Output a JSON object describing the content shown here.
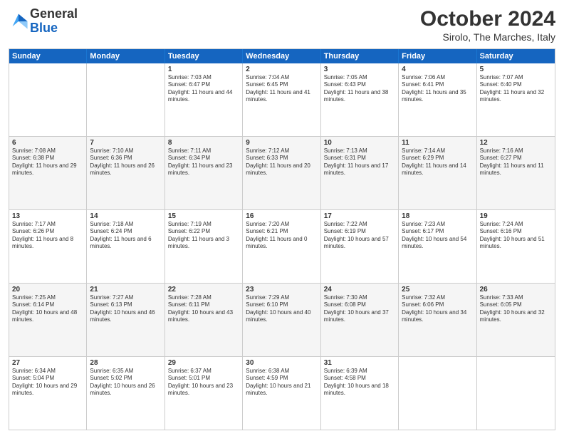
{
  "header": {
    "logo_general": "General",
    "logo_blue": "Blue",
    "month": "October 2024",
    "location": "Sirolo, The Marches, Italy"
  },
  "days_of_week": [
    "Sunday",
    "Monday",
    "Tuesday",
    "Wednesday",
    "Thursday",
    "Friday",
    "Saturday"
  ],
  "rows": [
    {
      "alt": false,
      "cells": [
        {
          "day": "",
          "text": ""
        },
        {
          "day": "",
          "text": ""
        },
        {
          "day": "1",
          "text": "Sunrise: 7:03 AM\nSunset: 6:47 PM\nDaylight: 11 hours and 44 minutes."
        },
        {
          "day": "2",
          "text": "Sunrise: 7:04 AM\nSunset: 6:45 PM\nDaylight: 11 hours and 41 minutes."
        },
        {
          "day": "3",
          "text": "Sunrise: 7:05 AM\nSunset: 6:43 PM\nDaylight: 11 hours and 38 minutes."
        },
        {
          "day": "4",
          "text": "Sunrise: 7:06 AM\nSunset: 6:41 PM\nDaylight: 11 hours and 35 minutes."
        },
        {
          "day": "5",
          "text": "Sunrise: 7:07 AM\nSunset: 6:40 PM\nDaylight: 11 hours and 32 minutes."
        }
      ]
    },
    {
      "alt": true,
      "cells": [
        {
          "day": "6",
          "text": "Sunrise: 7:08 AM\nSunset: 6:38 PM\nDaylight: 11 hours and 29 minutes."
        },
        {
          "day": "7",
          "text": "Sunrise: 7:10 AM\nSunset: 6:36 PM\nDaylight: 11 hours and 26 minutes."
        },
        {
          "day": "8",
          "text": "Sunrise: 7:11 AM\nSunset: 6:34 PM\nDaylight: 11 hours and 23 minutes."
        },
        {
          "day": "9",
          "text": "Sunrise: 7:12 AM\nSunset: 6:33 PM\nDaylight: 11 hours and 20 minutes."
        },
        {
          "day": "10",
          "text": "Sunrise: 7:13 AM\nSunset: 6:31 PM\nDaylight: 11 hours and 17 minutes."
        },
        {
          "day": "11",
          "text": "Sunrise: 7:14 AM\nSunset: 6:29 PM\nDaylight: 11 hours and 14 minutes."
        },
        {
          "day": "12",
          "text": "Sunrise: 7:16 AM\nSunset: 6:27 PM\nDaylight: 11 hours and 11 minutes."
        }
      ]
    },
    {
      "alt": false,
      "cells": [
        {
          "day": "13",
          "text": "Sunrise: 7:17 AM\nSunset: 6:26 PM\nDaylight: 11 hours and 8 minutes."
        },
        {
          "day": "14",
          "text": "Sunrise: 7:18 AM\nSunset: 6:24 PM\nDaylight: 11 hours and 6 minutes."
        },
        {
          "day": "15",
          "text": "Sunrise: 7:19 AM\nSunset: 6:22 PM\nDaylight: 11 hours and 3 minutes."
        },
        {
          "day": "16",
          "text": "Sunrise: 7:20 AM\nSunset: 6:21 PM\nDaylight: 11 hours and 0 minutes."
        },
        {
          "day": "17",
          "text": "Sunrise: 7:22 AM\nSunset: 6:19 PM\nDaylight: 10 hours and 57 minutes."
        },
        {
          "day": "18",
          "text": "Sunrise: 7:23 AM\nSunset: 6:17 PM\nDaylight: 10 hours and 54 minutes."
        },
        {
          "day": "19",
          "text": "Sunrise: 7:24 AM\nSunset: 6:16 PM\nDaylight: 10 hours and 51 minutes."
        }
      ]
    },
    {
      "alt": true,
      "cells": [
        {
          "day": "20",
          "text": "Sunrise: 7:25 AM\nSunset: 6:14 PM\nDaylight: 10 hours and 48 minutes."
        },
        {
          "day": "21",
          "text": "Sunrise: 7:27 AM\nSunset: 6:13 PM\nDaylight: 10 hours and 46 minutes."
        },
        {
          "day": "22",
          "text": "Sunrise: 7:28 AM\nSunset: 6:11 PM\nDaylight: 10 hours and 43 minutes."
        },
        {
          "day": "23",
          "text": "Sunrise: 7:29 AM\nSunset: 6:10 PM\nDaylight: 10 hours and 40 minutes."
        },
        {
          "day": "24",
          "text": "Sunrise: 7:30 AM\nSunset: 6:08 PM\nDaylight: 10 hours and 37 minutes."
        },
        {
          "day": "25",
          "text": "Sunrise: 7:32 AM\nSunset: 6:06 PM\nDaylight: 10 hours and 34 minutes."
        },
        {
          "day": "26",
          "text": "Sunrise: 7:33 AM\nSunset: 6:05 PM\nDaylight: 10 hours and 32 minutes."
        }
      ]
    },
    {
      "alt": false,
      "cells": [
        {
          "day": "27",
          "text": "Sunrise: 6:34 AM\nSunset: 5:04 PM\nDaylight: 10 hours and 29 minutes."
        },
        {
          "day": "28",
          "text": "Sunrise: 6:35 AM\nSunset: 5:02 PM\nDaylight: 10 hours and 26 minutes."
        },
        {
          "day": "29",
          "text": "Sunrise: 6:37 AM\nSunset: 5:01 PM\nDaylight: 10 hours and 23 minutes."
        },
        {
          "day": "30",
          "text": "Sunrise: 6:38 AM\nSunset: 4:59 PM\nDaylight: 10 hours and 21 minutes."
        },
        {
          "day": "31",
          "text": "Sunrise: 6:39 AM\nSunset: 4:58 PM\nDaylight: 10 hours and 18 minutes."
        },
        {
          "day": "",
          "text": ""
        },
        {
          "day": "",
          "text": ""
        }
      ]
    }
  ]
}
